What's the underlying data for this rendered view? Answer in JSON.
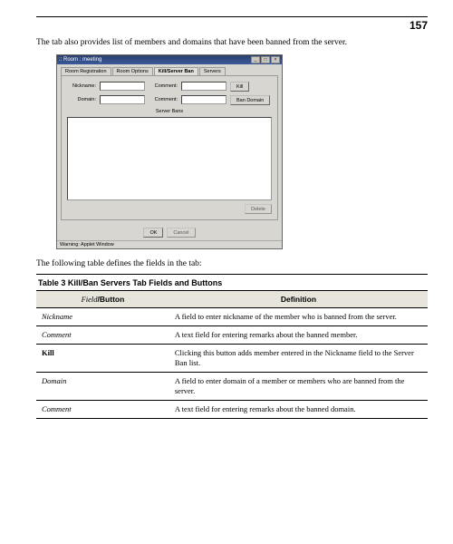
{
  "page_number": "157",
  "intro_text": "The tab also provides list of members and domains that have been banned from the server.",
  "followup_text": "The following table defines the fields in the tab:",
  "window": {
    "title": ":: Room : meeting",
    "tabs": {
      "t0": "Room Registration",
      "t1": "Room Options",
      "t2": "Kill/Server Ban",
      "t3": "Servers"
    },
    "labels": {
      "nickname": "Nickname:",
      "comment": "Comment:",
      "domain": "Domain:",
      "comment2": "Comment:",
      "section": "Server Bans"
    },
    "buttons": {
      "kill": "Kill",
      "bandomain": "Ban Domain",
      "delete": "Delete",
      "ok": "OK",
      "cancel": "Cancel"
    },
    "status": "Warning: Applet Window"
  },
  "table": {
    "caption": "Table 3  Kill/Ban Servers Tab Fields and Buttons",
    "head_field_italic": "Field",
    "head_field_sep": "/",
    "head_field_bold": "Button",
    "head_def": "Definition",
    "rows": [
      {
        "name": "Nickname",
        "bold": false,
        "def": "A field to enter nickname of the member who is banned from the server."
      },
      {
        "name": "Comment",
        "bold": false,
        "def": "A text field for entering remarks about the banned member."
      },
      {
        "name": "Kill",
        "bold": true,
        "def": "Clicking this button adds member entered in the Nickname field to the Server Ban list."
      },
      {
        "name": "Domain",
        "bold": false,
        "def": "A field to enter domain of a member or members who are banned from the server."
      },
      {
        "name": "Comment",
        "bold": false,
        "def": "A text field for entering remarks about the banned domain."
      }
    ]
  }
}
